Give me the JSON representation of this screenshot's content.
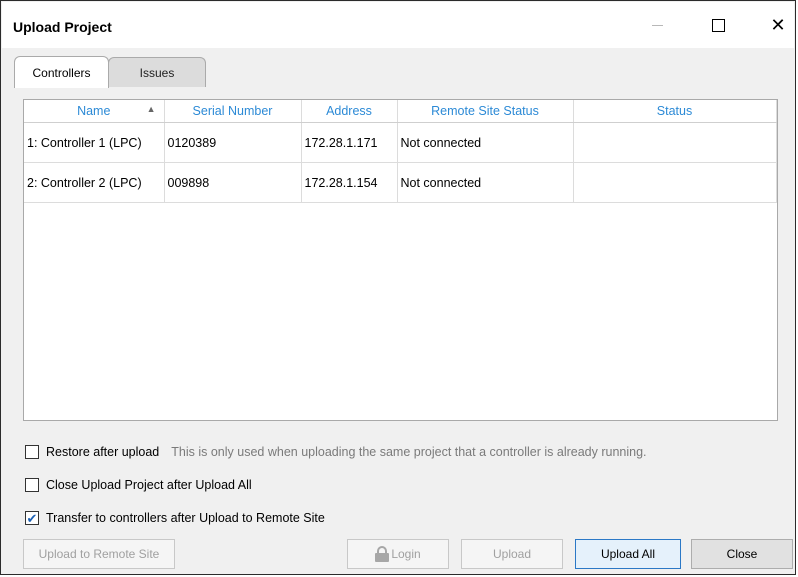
{
  "window": {
    "title": "Upload Project",
    "close_glyph": "✕"
  },
  "tabs": [
    {
      "label": "Controllers",
      "active": true
    },
    {
      "label": "Issues",
      "active": false
    }
  ],
  "grid": {
    "columns": [
      "Name",
      "Serial Number",
      "Address",
      "Remote Site Status",
      "Status"
    ],
    "sort_column": "Name",
    "sort_direction": "ascending",
    "rows": [
      {
        "name": "1: Controller 1 (LPC)",
        "serial": "0120389",
        "address": "172.28.1.171",
        "remote_status": "Not connected",
        "status": ""
      },
      {
        "name": "2: Controller 2 (LPC)",
        "serial": "009898",
        "address": "172.28.1.154",
        "remote_status": "Not connected",
        "status": ""
      }
    ]
  },
  "options": {
    "restore": {
      "label": "Restore after upload",
      "hint": "This is only used when uploading the same project that a controller is already running.",
      "checked": false
    },
    "close_after": {
      "label": "Close Upload Project after Upload All",
      "checked": false
    },
    "transfer": {
      "label": "Transfer to controllers after Upload to Remote Site",
      "checked": true,
      "check_glyph": "✔"
    }
  },
  "buttons": {
    "upload_remote": "Upload to Remote Site",
    "login": "Login",
    "upload": "Upload",
    "upload_all": "Upload All",
    "close": "Close"
  },
  "colors": {
    "accent": "#2c8ad6",
    "disabled_text": "#a0a0a0",
    "hint_text": "#7a7a7a"
  }
}
